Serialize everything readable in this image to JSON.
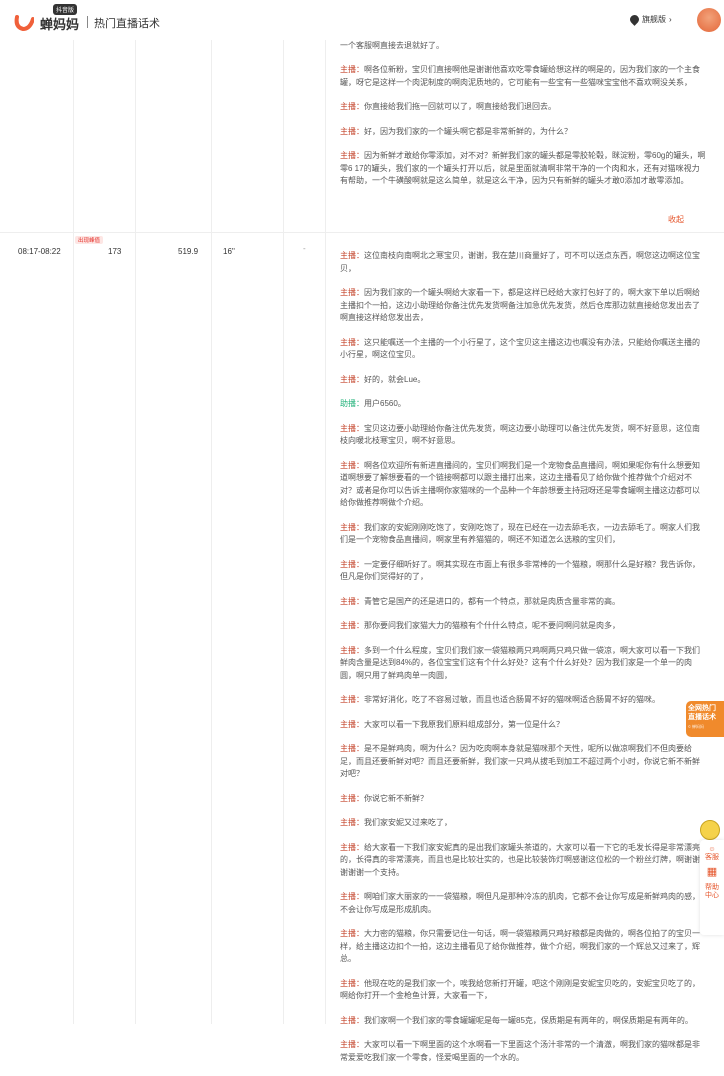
{
  "header": {
    "badge": "抖音版",
    "brand": "蝉妈妈",
    "title": "热门直播话术",
    "plan": "旗舰版",
    "plan_arrow": "›"
  },
  "rows": [
    {
      "entries": [
        {
          "speaker": "主播：",
          "text": "直接给我们退回来就好了，啊对啊直接给我们退回来就好了，这个供吃家的宝贝你直接去联系我们家的一个客服啊直接去退就好了。",
          "first_hidden": true
        },
        {
          "speaker": "主播：",
          "text": "啊各位新粉，宝贝们直接啊他是谢谢他喜欢吃零食罐给想这样的啊是的，因为我们家的一个主食罐，呀它是这样一个肉泥制度的啊肉泥质地的，它可能有一些宝有一些猫咪宝宝他不喜欢啊没关系，"
        },
        {
          "speaker": "主播：",
          "text": "你直接给我们拖一回就可以了，啊直接给我们退回去。"
        },
        {
          "speaker": "主播：",
          "text": "好，因为我们家的一个罐头啊它都是非常新鲜的，为什么？"
        },
        {
          "speaker": "主播：",
          "text": "因为新鲜才敢给你零添加，对不对？新鲜我们家的罐头都是零胶轮毂，眯淀粉，零60g的罐头，啊零6 17的罐头，我们家的一个罐头打开以后，就是里面就清啊非常干净的一个肉和水，还有对猫咪视力有帮助，一个牛磺酸啊就是这么简单，就是这么干净，因为只有新鲜的罐头才敢0添加才敢零添加。"
        }
      ],
      "collapse": "收起"
    },
    {
      "time": "08:17-08:22",
      "tag": "出现峰值",
      "c1": "173",
      "c2": "519.9",
      "c3": "16''",
      "c4": "-",
      "entries": [
        {
          "speaker": "主播：",
          "text": "这位南枝向南啊北之寒宝贝，谢谢，我在楚川商量好了，可不可以送点东西，啊您这边啊这位宝贝，"
        },
        {
          "speaker": "主播：",
          "text": "因为我们家的一个罐头啊给大家看一下，都是这样已经给大家打包好了的，啊大家下单以后啊给主播扣个一拍，这边小助理给你备注优先发货啊备注加急优先发货，然后仓库那边就直接给您发出去了啊直接这样给您发出去，"
        },
        {
          "speaker": "主播：",
          "text": "这只能嘱送一个主播的一个小行星了，这个宝贝这主播这边也嘱没有办法，只能给你嘱送主播的小行星，啊这位宝贝。"
        },
        {
          "speaker": "主播：",
          "text": "好的，就会Lue。"
        },
        {
          "speaker": "助播：",
          "text": "用户6560。",
          "assist": true
        },
        {
          "speaker": "主播：",
          "text": "宝贝这边要小助理给你备注优先发货，啊这边要小助理可以备注优先发货，啊不好意思，这位南枝向暖北枝寒宝贝，啊不好意思。"
        },
        {
          "speaker": "主播：",
          "text": "啊各位欢迎所有新进直播间的，宝贝们啊我们是一个宠物食品直播间，啊如果呢你有什么想要知道啊想要了解想要看的一个链接啊都可以跟主播打出来，这边主播看见了给你做个推荐做个介绍对不对？或者是你可以告诉主播啊你家猫咪的一个品种一个年龄想要主持冠呀还是零食罐啊主播这边都可以给你做推荐啊做个介绍。"
        },
        {
          "speaker": "主播：",
          "text": "我们家的安妮刚刚吃饱了，安刚吃饱了，现在已经在一边去舔毛衣，一边去舔毛了。啊家人们我们是一个宠物食品直播间，啊家里有养猫猫的，啊还不知道怎么选粮的宝贝们，"
        },
        {
          "speaker": "主播：",
          "text": "一定要仔细听好了。啊其实现在市面上有很多非常棒的一个猫粮，啊那什么是好粮？我告诉你，但凡是你们觉得好的了，"
        },
        {
          "speaker": "主播：",
          "text": "青管它是国产的还是进口的，都有一个特点，那就是肉质含量非常的高。"
        },
        {
          "speaker": "主播：",
          "text": "那你要问我们家猫大力的猫粮有个什什么特点，呢不要问啊问就是肉多，"
        },
        {
          "speaker": "主播：",
          "text": "多到一个什么程度，宝贝们我们家一袋猫粮两只鸡啊两只鸡只做一袋凉，啊大家可以看一下我们鲜肉含量是达到84%的，各位宝宝们这有个什么好处？这有个什么好处？因为我们家是一个单一的肉圆，啊只用了鲜鸡肉单一肉圆，"
        },
        {
          "speaker": "主播：",
          "text": "非常好消化，吃了不容易过敏，而且也适合肠胃不好的猫咪啊适合肠胃不好的猫咪。"
        },
        {
          "speaker": "主播：",
          "text": "大家可以看一下我原我们原料组成部分，第一位是什么？"
        },
        {
          "speaker": "主播：",
          "text": "是不是鲜鸡肉，啊为什么？因为吃肉啊本身就是猫咪那个天性，呢所以做凉啊我们不但肉要给足，而且还要新鲜对吧？而且还要新鲜，我们家一只鸡从拔毛到加工不超过两个小时，你说它新不新鲜对吧？"
        },
        {
          "speaker": "主播：",
          "text": "你说它新不新鲜？"
        },
        {
          "speaker": "主播：",
          "text": "我们家安妮又过来吃了，"
        },
        {
          "speaker": "主播：",
          "text": "给大家看一下我们家安妮真的是出我们家罐头茶道的，大家可以看一下它的毛发长得是非常漂亮的，长得真的非常漂亮，而且也是比较壮实的，也是比较装饰灯啊感谢这位松的一个粉丝灯牌，啊谢谢谢谢谢一个支持。"
        },
        {
          "speaker": "主播：",
          "text": "啊咱们家大丽家的一一袋猫粮，啊但凡是那种冷冻的肌肉，它都不会让你写成是新鲜鸡肉的感，不会让你写成是形成肌肉。"
        },
        {
          "speaker": "主播：",
          "text": "大力密的猫粮，你只需要记住一句话，啊一袋猫粮两只鸡好粮都是肉做的，啊各位拍了的宝贝一样，给主播这边扣个一拍，这边主播看见了给你做推荐，做个介绍，啊我们家的一个辉总又过来了，辉总。"
        },
        {
          "speaker": "主播：",
          "text": "他现在吃的是我们家一个，唉我给您新打开罐，吧这个刚刚是安妮宝贝吃的，安妮宝贝吃了的，啊给你打开一个金枪鱼计算，大家看一下，"
        },
        {
          "speaker": "主播：",
          "text": "我们家啊一个我们家的零食罐罐呢是每一罐85克，保质期是有两年的，啊保质期是有两年的。"
        },
        {
          "speaker": "主播：",
          "text": "大家可以看一下啊里面的这个水啊看一下里面这个汤汁非常的一个清澈，啊我们家的猫咪都是非常爱爱吃我们家一个零食，怪爱喝里面的一个水的。"
        }
      ]
    }
  ],
  "promo": {
    "line1": "全网热门",
    "line2": "直播话术",
    "sub": "© 蝉妈妈"
  },
  "tools": {
    "service": "客服",
    "help": "帮助中心"
  },
  "colors": {
    "accent": "#e5542a",
    "host": "#c4442b",
    "assistant": "#22b27a"
  }
}
